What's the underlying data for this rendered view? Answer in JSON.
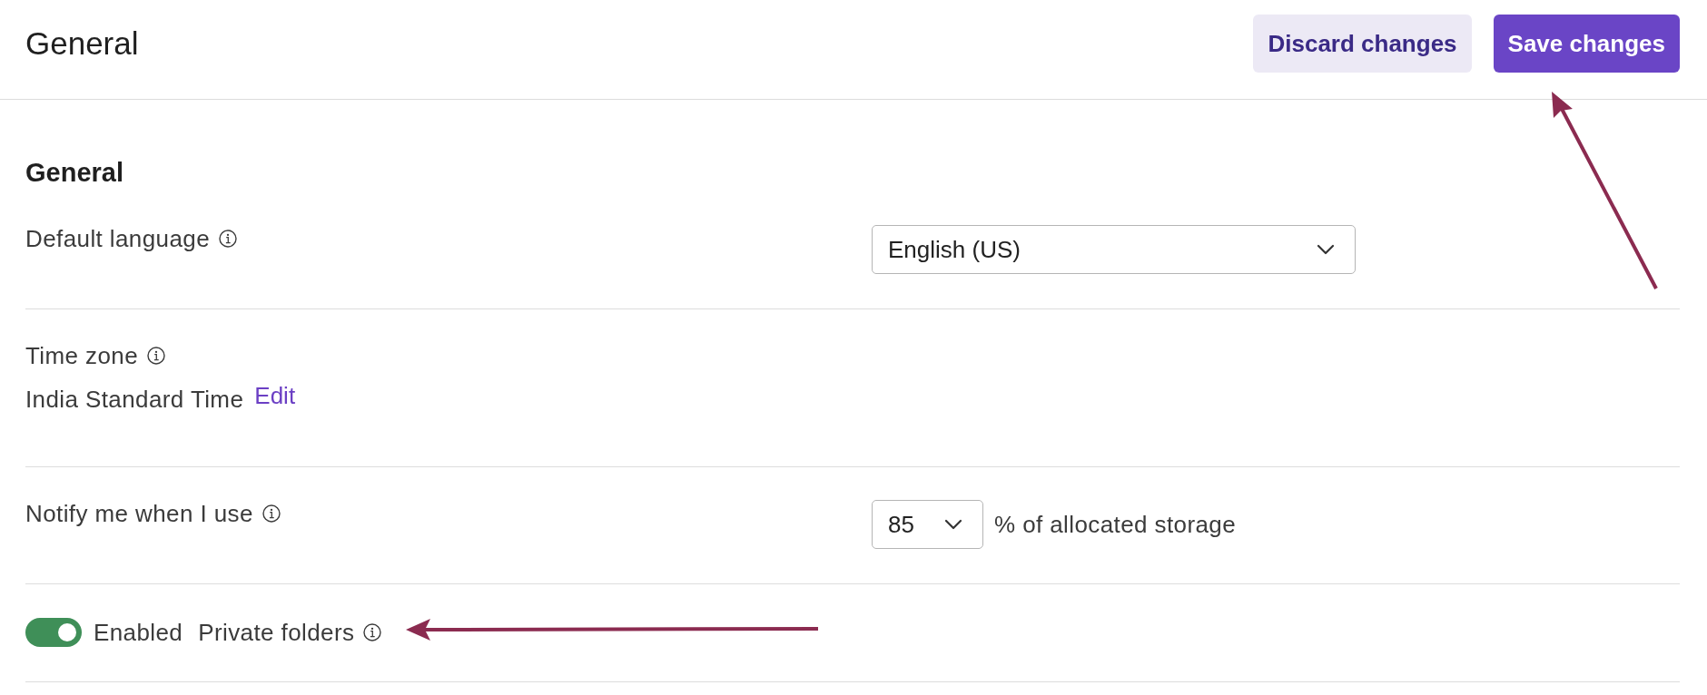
{
  "header": {
    "title": "General",
    "buttons": [
      {
        "label": "Discard changes",
        "kind": "secondary"
      },
      {
        "label": "Save changes",
        "kind": "primary"
      }
    ]
  },
  "section": {
    "heading": "General",
    "settings": [
      {
        "kind": "select",
        "label": "Default language",
        "info": true,
        "value": "English (US)"
      },
      {
        "kind": "timezone",
        "label": "Time zone",
        "info": true,
        "value": "India Standard Time",
        "link": "Edit"
      },
      {
        "kind": "threshold",
        "label": "Notify me when I use",
        "info": true,
        "value": "85",
        "suffix": "% of allocated storage"
      },
      {
        "kind": "toggle",
        "on": true,
        "state_label": "Enabled",
        "label": "Private folders",
        "info": true
      }
    ]
  }
}
